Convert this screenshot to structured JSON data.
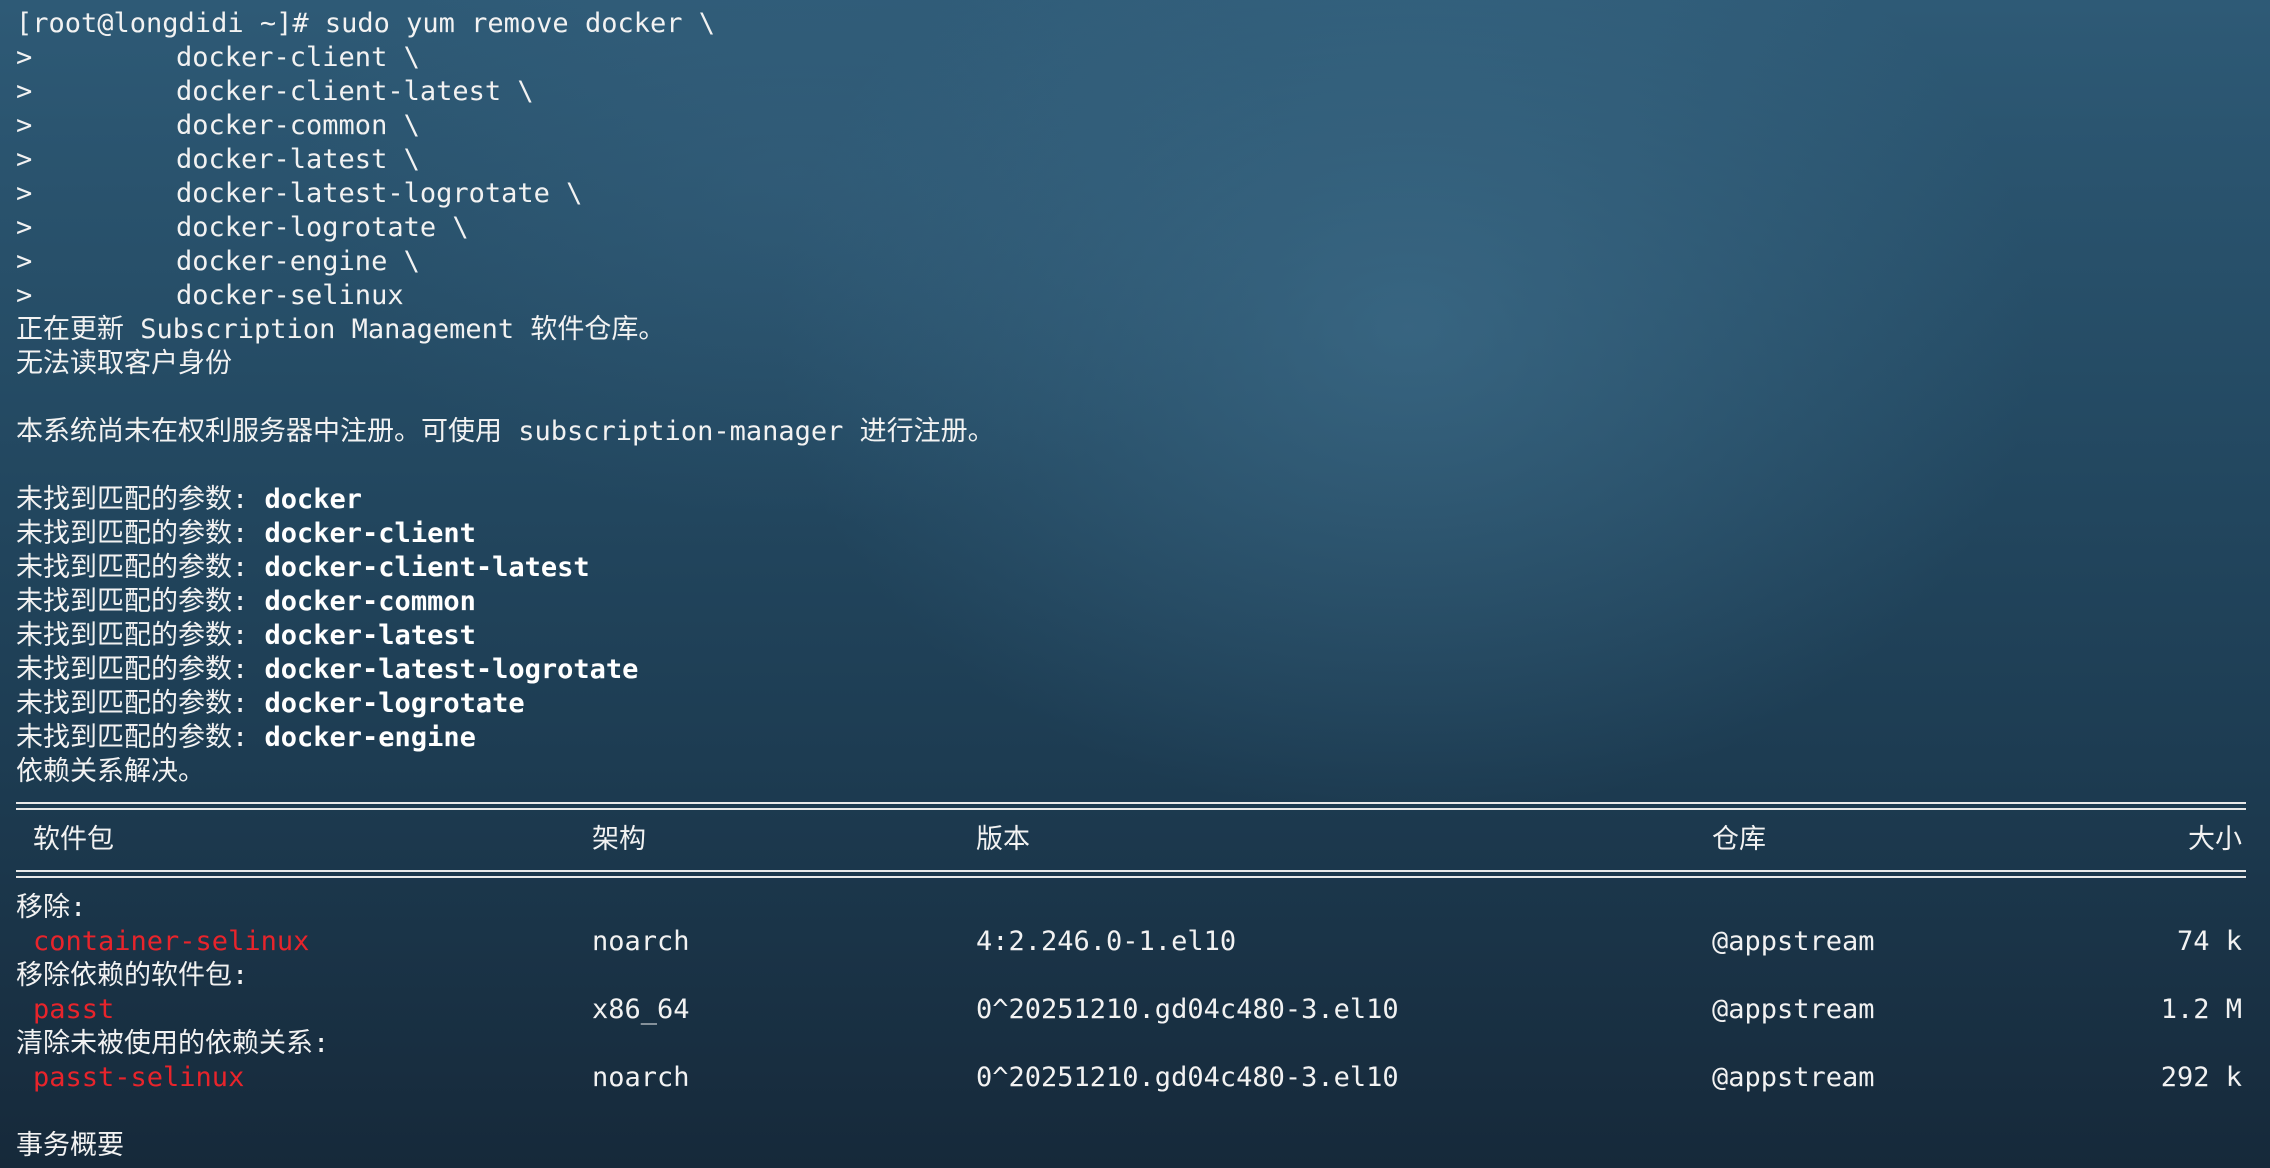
{
  "terminal": {
    "command_line": "[root@longdidi ~]# sudo yum remove docker \\",
    "continuations": [
      {
        "prompt": ">",
        "text": "docker-client \\"
      },
      {
        "prompt": ">",
        "text": "docker-client-latest \\"
      },
      {
        "prompt": ">",
        "text": "docker-common \\"
      },
      {
        "prompt": ">",
        "text": "docker-latest \\"
      },
      {
        "prompt": ">",
        "text": "docker-latest-logrotate \\"
      },
      {
        "prompt": ">",
        "text": "docker-logrotate \\"
      },
      {
        "prompt": ">",
        "text": "docker-engine \\"
      },
      {
        "prompt": ">",
        "text": "docker-selinux"
      }
    ],
    "messages": {
      "updating_repos": "正在更新 Subscription Management 软件仓库。",
      "no_identity": "无法读取客户身份",
      "not_registered": "本系统尚未在权利服务器中注册。可使用 subscription-manager 进行注册。",
      "deps_resolved": "依赖关系解决。",
      "summary_heading": "事务概要"
    },
    "no_match": {
      "prefix": "未找到匹配的参数: ",
      "args": [
        "docker",
        "docker-client",
        "docker-client-latest",
        "docker-common",
        "docker-latest",
        "docker-latest-logrotate",
        "docker-logrotate",
        "docker-engine"
      ]
    },
    "table": {
      "headers": {
        "package": "软件包",
        "arch": "架构",
        "version": "版本",
        "repo": "仓库",
        "size": "大小"
      },
      "groups": [
        {
          "title": "移除:",
          "rows": [
            {
              "name": "container-selinux",
              "arch": "noarch",
              "version": "4:2.246.0-1.el10",
              "repo": "@appstream",
              "size": "74 k"
            }
          ]
        },
        {
          "title": "移除依赖的软件包:",
          "rows": [
            {
              "name": "passt",
              "arch": "x86_64",
              "version": "0^20251210.gd04c480-3.el10",
              "repo": "@appstream",
              "size": "1.2 M"
            }
          ]
        },
        {
          "title": "清除未被使用的依赖关系:",
          "rows": [
            {
              "name": "passt-selinux",
              "arch": "noarch",
              "version": "0^20251210.gd04c480-3.el10",
              "repo": "@appstream",
              "size": "292 k"
            }
          ]
        }
      ]
    },
    "colors": {
      "text": "#f2f2f2",
      "package_name": "#e8242b",
      "background_top": "#2e5a76",
      "background_bottom": "#16293a"
    }
  }
}
